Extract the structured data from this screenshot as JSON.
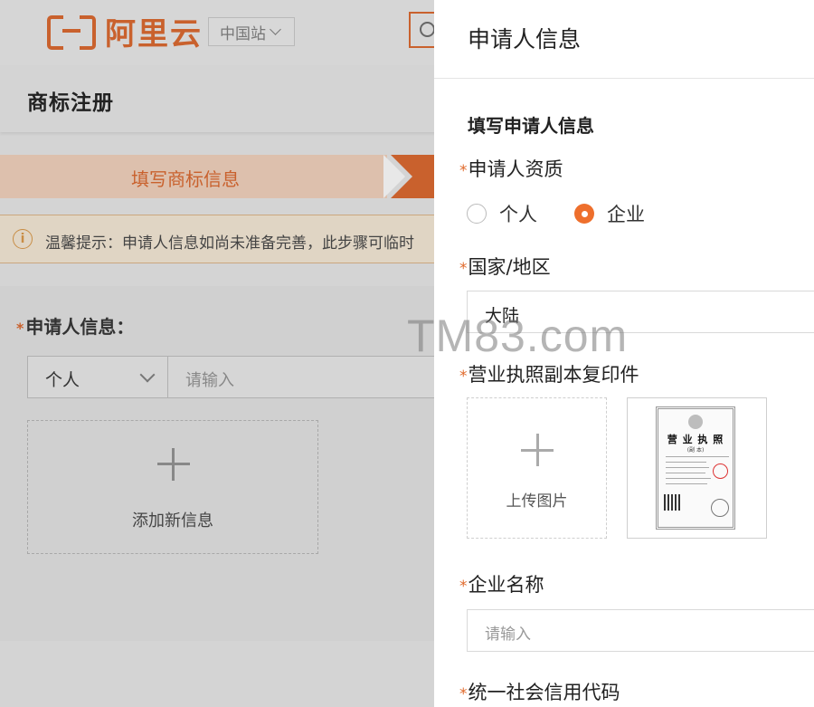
{
  "header": {
    "logo_text": "阿里云",
    "site_selector": "中国站"
  },
  "page": {
    "title": "商标注册",
    "step_active": "填写商标信息",
    "tip": "温馨提示：申请人信息如尚未准备完善，此步骤可临时",
    "applicant_label": "申请人信息：",
    "type_value": "个人",
    "name_placeholder": "请输入",
    "add_new_label": "添加新信息"
  },
  "drawer": {
    "title": "申请人信息",
    "section_title": "填写申请人信息",
    "qualification_label": "申请人资质",
    "radio_personal": "个人",
    "radio_enterprise": "企业",
    "radio_selected": "企业",
    "region_label": "国家/地区",
    "region_value": "大陆",
    "license_label": "营业执照副本复印件",
    "upload_label": "上传图片",
    "sample_license_title": "营 业 执 照",
    "sample_license_sub": "(副 本)",
    "company_name_label": "企业名称",
    "company_name_placeholder": "请输入",
    "credit_code_label": "统一社会信用代码"
  },
  "watermark": "TM83.com",
  "colors": {
    "accent": "#ee6f2c",
    "brand_dimmed": "#c9612d",
    "overlay_bg": "#d4d4d4"
  }
}
